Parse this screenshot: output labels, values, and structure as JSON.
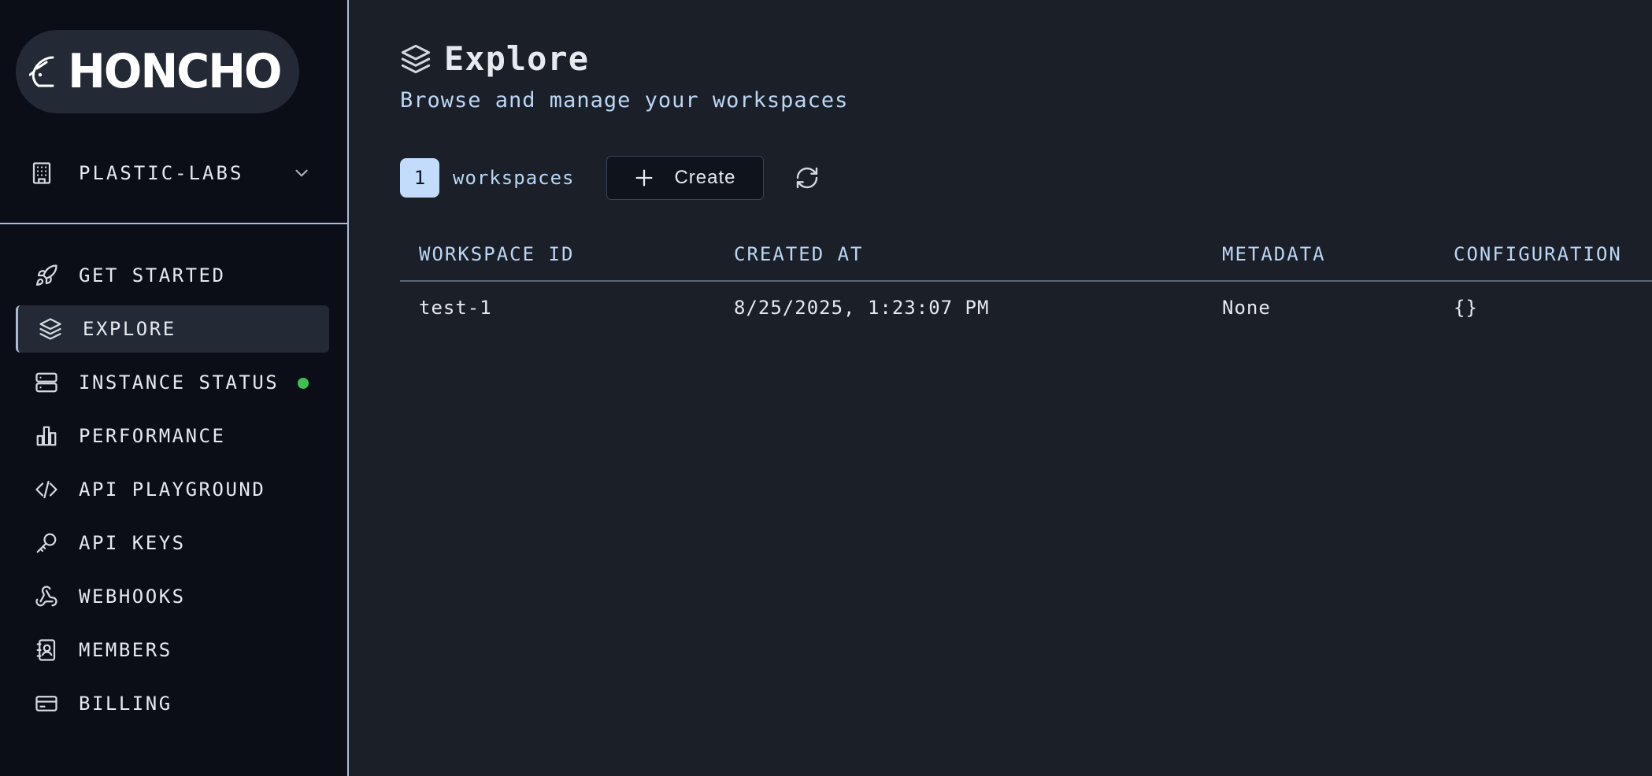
{
  "brand": {
    "logo_text": "HONCHO"
  },
  "org": {
    "name": "PLASTIC-LABS",
    "icon": "building-icon"
  },
  "nav": {
    "items": [
      {
        "label": "GET STARTED",
        "icon": "rocket-icon",
        "active": false
      },
      {
        "label": "EXPLORE",
        "icon": "layers-icon",
        "active": true
      },
      {
        "label": "INSTANCE STATUS",
        "icon": "server-icon",
        "active": false,
        "status": "online"
      },
      {
        "label": "PERFORMANCE",
        "icon": "bar-chart-icon",
        "active": false
      },
      {
        "label": "API PLAYGROUND",
        "icon": "code-icon",
        "active": false
      },
      {
        "label": "API KEYS",
        "icon": "key-icon",
        "active": false
      },
      {
        "label": "WEBHOOKS",
        "icon": "webhook-icon",
        "active": false
      },
      {
        "label": "MEMBERS",
        "icon": "contact-book-icon",
        "active": false
      },
      {
        "label": "BILLING",
        "icon": "credit-card-icon",
        "active": false
      }
    ]
  },
  "page": {
    "title": "Explore",
    "subtitle": "Browse and manage your workspaces"
  },
  "toolbar": {
    "count": "1",
    "count_label": "workspaces",
    "create_label": "Create"
  },
  "table": {
    "headers": [
      "WORKSPACE ID",
      "CREATED AT",
      "METADATA",
      "CONFIGURATION"
    ],
    "rows": [
      [
        "test-1",
        "8/25/2025, 1:23:07 PM",
        "None",
        "{}"
      ]
    ]
  },
  "colors": {
    "sidebar_bg": "#0b0e17",
    "main_bg": "#1a1f28",
    "accent_light_blue": "#c4dcfb",
    "status_online": "#3fbf53"
  }
}
